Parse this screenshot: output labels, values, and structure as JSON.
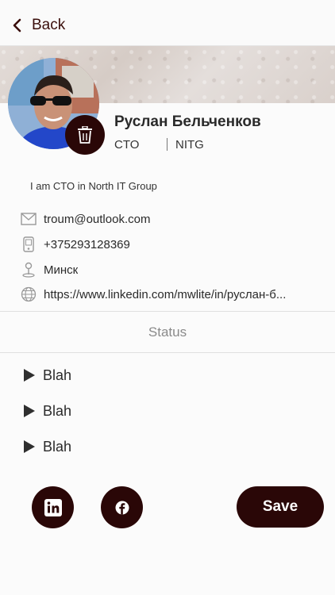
{
  "nav": {
    "back_label": "Back"
  },
  "profile": {
    "name": "Руслан Бельченков",
    "role": "CTO",
    "company": "NITG",
    "bio": "I am CTO in North IT Group"
  },
  "contacts": {
    "email": "troum@outlook.com",
    "phone": "+375293128369",
    "location": "Минск",
    "website": "https://www.linkedin.com/mwlite/in/руслан-б..."
  },
  "status": {
    "title": "Status",
    "items": [
      "Blah",
      "Blah",
      "Blah"
    ]
  },
  "actions": {
    "save_label": "Save"
  },
  "icons": {
    "back": "chevron-left-icon",
    "delete": "trash-icon",
    "email": "envelope-icon",
    "phone": "mobile-phone-icon",
    "location": "pin-icon",
    "website": "globe-icon",
    "linkedin": "linkedin-icon",
    "facebook": "facebook-icon"
  },
  "colors": {
    "accent": "#2a0707",
    "back_text": "#3a0e0b"
  }
}
